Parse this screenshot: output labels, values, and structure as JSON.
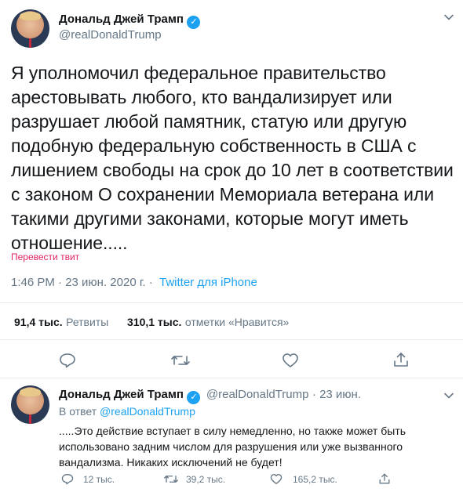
{
  "tweet": {
    "author_name": "Дональд Джей Трамп",
    "author_handle": "@realDonaldTrump",
    "text": "Я уполномочил федеральное правительство арестовывать любого, кто вандализирует или разрушает любой памятник, статую или другую подобную федеральную собственность в США с лишением свободы на срок до 10 лет в соответствии с законом О сохранении Мемориала ветерана или такими другими законами, которые могут иметь отношение.....",
    "translate_label": "Перевести твит",
    "timestamp": "1:46 PM · 23 июн. 2020 г. ·",
    "source": "Twitter для iPhone",
    "retweets_count": "91,4 тыс.",
    "retweets_label": "Ретвиты",
    "likes_count": "310,1 тыс.",
    "likes_label": "отметки «Нравится»"
  },
  "reply": {
    "author_name": "Дональд Джей Трамп",
    "author_handle": "@realDonaldTrump",
    "date": "· 23 июн.",
    "in_reply_prefix": "В ответ",
    "in_reply_handle": "@realDonaldTrump",
    "text": ".....Это действие вступает в силу немедленно, но также может быть использовано задним числом для разрушения или уже вызванного вандализма. Никаких исключений не будет!",
    "reply_count": "12 тыс.",
    "retweet_count": "39,2 тыс.",
    "like_count": "165,2 тыс."
  },
  "icons": {
    "chevron": "chevron-down-icon",
    "verified": "verified-badge-icon",
    "reply": "reply-icon",
    "retweet": "retweet-icon",
    "like": "heart-icon",
    "share": "share-icon"
  },
  "colors": {
    "accent": "#1da1f2",
    "translate": "#e0245e",
    "muted": "#657786",
    "text": "#14171a"
  }
}
